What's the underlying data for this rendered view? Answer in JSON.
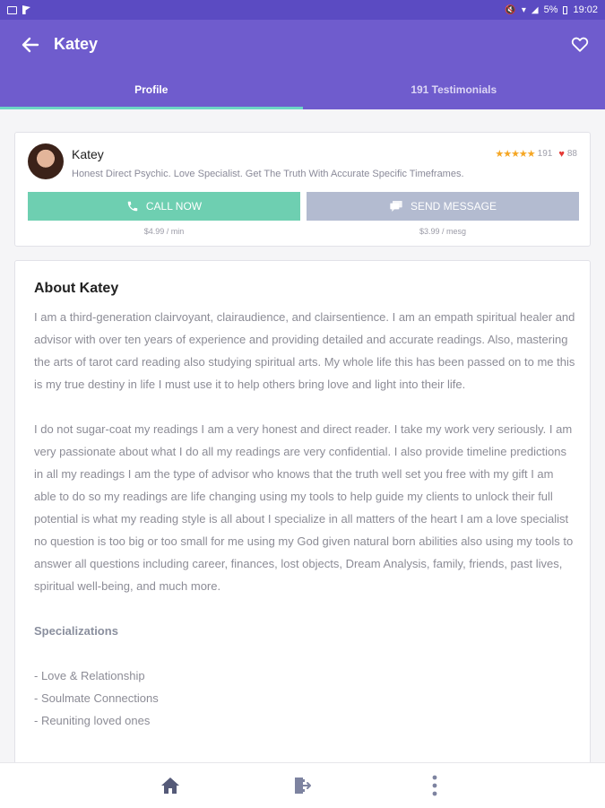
{
  "status_bar": {
    "battery": "5%",
    "time": "19:02"
  },
  "app_bar": {
    "title": "Katey",
    "tabs": [
      {
        "label": "Profile",
        "active": true
      },
      {
        "label": "191 Testimonials",
        "active": false
      }
    ]
  },
  "advisor": {
    "name": "Katey",
    "tagline": "Honest Direct Psychic. Love Specialist. Get The Truth With Accurate Specific Timeframes.",
    "rating_stars": 5,
    "review_count": "191",
    "favorites_count": "88",
    "call_button": "CALL NOW",
    "call_price": "$4.99 / min",
    "message_button": "SEND MESSAGE",
    "message_price": "$3.99 / mesg"
  },
  "about": {
    "title": "About Katey",
    "paragraphs": [
      "I am a third-generation clairvoyant, clairaudience, and clairsentience. I am an empath spiritual healer and advisor with over ten years of experience and providing detailed and accurate readings. Also, mastering the arts of tarot card reading also studying spiritual arts. My whole life this has been passed on to me this is my true destiny in life I must use it to help others bring love and light into their life.",
      "I do not sugar-coat my readings I am a very honest and direct reader. I take my work very seriously. I am very passionate about what I do all my readings are very confidential. I also provide timeline predictions in all my readings I am the type of advisor who knows that the truth well set you free with my gift I am able to do so my readings are life changing using my tools to help guide my clients to unlock their full  potential  is what my reading style is all about I specialize in all matters of the heart I am a love specialist  no question is too big or too small for me using my God given natural born abilities also using my tools to answer all questions including  career, finances, lost objects, Dream Analysis, family, friends, past lives,  spiritual well-being, and much more."
    ],
    "specializations_title": "Specializations",
    "specializations": [
      "- Love & Relationship",
      "- Soulmate Connections",
      "- Reuniting loved ones"
    ]
  },
  "colors": {
    "app_bar": "#6f5ccd",
    "tab_indicator": "#6cd6c5",
    "call_button": "#6ecfb1",
    "message_button": "#b3bbd0",
    "star": "#f5a623",
    "heart": "#e53935"
  },
  "icons": {
    "back": "arrow-left-icon",
    "favorite": "heart-outline-icon",
    "call": "phone-icon",
    "message": "chat-icon",
    "home": "home-icon",
    "exit": "exit-door-icon",
    "more": "more-vertical-icon"
  }
}
